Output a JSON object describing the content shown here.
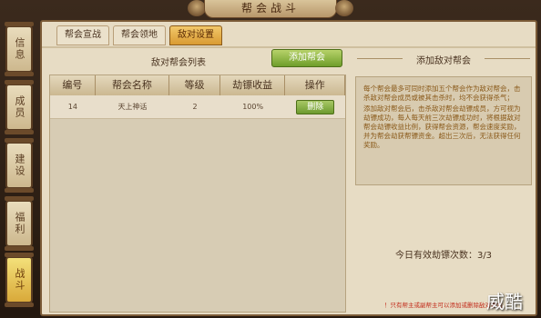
{
  "window": {
    "title": "帮会战斗"
  },
  "sidebar": {
    "items": [
      {
        "label": "信息",
        "active": false
      },
      {
        "label": "成员",
        "active": false
      },
      {
        "label": "建设",
        "active": false
      },
      {
        "label": "福利",
        "active": false
      },
      {
        "label": "战斗",
        "active": true
      }
    ]
  },
  "tabs": [
    {
      "label": "帮会宣战",
      "active": false
    },
    {
      "label": "帮会领地",
      "active": false
    },
    {
      "label": "敌对设置",
      "active": true
    }
  ],
  "enemy_list": {
    "title": "敌对帮会列表",
    "add_button": "添加帮会",
    "columns": [
      "编号",
      "帮会名称",
      "等级",
      "劫镖收益",
      "操作"
    ],
    "rows": [
      {
        "id": "14",
        "name": "天上神话",
        "level": "2",
        "income": "100%",
        "action": "删除"
      }
    ]
  },
  "add_panel": {
    "title": "添加敌对帮会",
    "rules": [
      "每个帮会最多可同时添加五个帮会作为敌对帮会，击杀敌对帮会成员或被其击杀时，均不会获得杀气；",
      "添加敌对帮会后，击杀敌对帮会劫镖成员，方可视为劫镖成功，每人每天前三次劫镖成功时，将根据敌对帮会劫镖收益比例，获得帮会资源，帮会速度奖励，并为帮会劫获帮镖资金。超出三次后，无法获得任何奖励。"
    ],
    "count_text": "今日有效劫镖次数：3/3",
    "notice": "！只有帮主或副帮主可以添加或删除敌对帮会"
  },
  "watermark": "威酷"
}
